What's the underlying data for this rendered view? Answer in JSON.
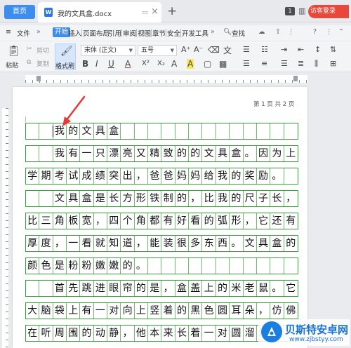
{
  "titlebar": {
    "home_tab": "首页",
    "doc_tab": "我的文具盒.docx",
    "doc_icon": "W",
    "add_tab": "+",
    "notification_count": "1",
    "visitor_login": "访客登录"
  },
  "ribbon": {
    "file_menu": "文件",
    "tabs": [
      "开始",
      "插入",
      "页面布局",
      "引用",
      "审阅",
      "视图",
      "章节",
      "安全",
      "开发工具"
    ],
    "active_tab": "开始",
    "search": "查找"
  },
  "toolbar": {
    "paste": "粘贴",
    "cut": "剪切",
    "copy": "复制",
    "format_painter": "格式刷",
    "font_name": "宋体 (正文)",
    "font_size": "五号",
    "bold": "B",
    "italic": "I",
    "underline": "U",
    "font_color": "A",
    "superscript": "X²",
    "subscript": "X₂",
    "grow_font": "A⁺",
    "shrink_font": "A⁻",
    "text_effects": "A",
    "highlight": "A"
  },
  "document": {
    "page_indicator": "第 1 页 共 2 页",
    "rows": [
      [
        "",
        "",
        "我",
        "的",
        "文",
        "具",
        "盒",
        "",
        "",
        "",
        "",
        "",
        "",
        "",
        "",
        "",
        "",
        "",
        "",
        ""
      ],
      [
        "",
        "",
        "我",
        "有",
        "一",
        "只",
        "漂",
        "亮",
        "又",
        "精",
        "致",
        "的",
        "的",
        "文",
        "具",
        "盒",
        "。",
        "因",
        "为",
        "上"
      ],
      [
        "学",
        "期",
        "考",
        "试",
        "成",
        "绩",
        "突",
        "出",
        "，",
        "爸",
        "爸",
        "妈",
        "妈",
        "给",
        "我",
        "的",
        "奖",
        "励",
        "。",
        ""
      ],
      [
        "",
        "",
        "文",
        "具",
        "盒",
        "是",
        "长",
        "方",
        "形",
        "铁",
        "制",
        "的",
        "，",
        "比",
        "我",
        "的",
        "尺",
        "子",
        "长",
        "，"
      ],
      [
        "比",
        "三",
        "角",
        "板",
        "宽",
        "，",
        "四",
        "个",
        "角",
        "都",
        "有",
        "好",
        "看",
        "的",
        "弧",
        "形",
        "，",
        "它",
        "还",
        "有"
      ],
      [
        "厚",
        "度",
        "，",
        "一",
        "看",
        "就",
        "知",
        "道",
        "，",
        "能",
        "装",
        "很",
        "多",
        "东",
        "西",
        "。",
        "文",
        "具",
        "盒",
        "的"
      ],
      [
        "颜",
        "色",
        "是",
        "粉",
        "粉",
        "嫩",
        "嫩",
        "的",
        "。",
        "",
        "",
        "",
        "",
        "",
        "",
        "",
        "",
        "",
        "",
        ""
      ],
      [
        "",
        "",
        "首",
        "先",
        "跳",
        "进",
        "眼",
        "帘",
        "的",
        "是",
        "，",
        "盒",
        "盖",
        "上",
        "的",
        "米",
        "老",
        "鼠",
        "。",
        "它"
      ],
      [
        "大",
        "脑",
        "袋",
        "上",
        "有",
        "一",
        "对",
        "向",
        "上",
        "竖",
        "着",
        "的",
        "黑",
        "色",
        "圆",
        "耳",
        "朵",
        "，",
        "仿",
        "佛"
      ],
      [
        "在",
        "听",
        "周",
        "围",
        "的",
        "动",
        "静",
        "，",
        "他",
        "本",
        "来",
        "长",
        "着",
        "一",
        "对",
        "圆",
        "溜",
        "溜",
        "",
        ""
      ]
    ]
  },
  "watermark": {
    "title": "贝斯特安卓网",
    "url": "www.zjbstyy.com"
  }
}
